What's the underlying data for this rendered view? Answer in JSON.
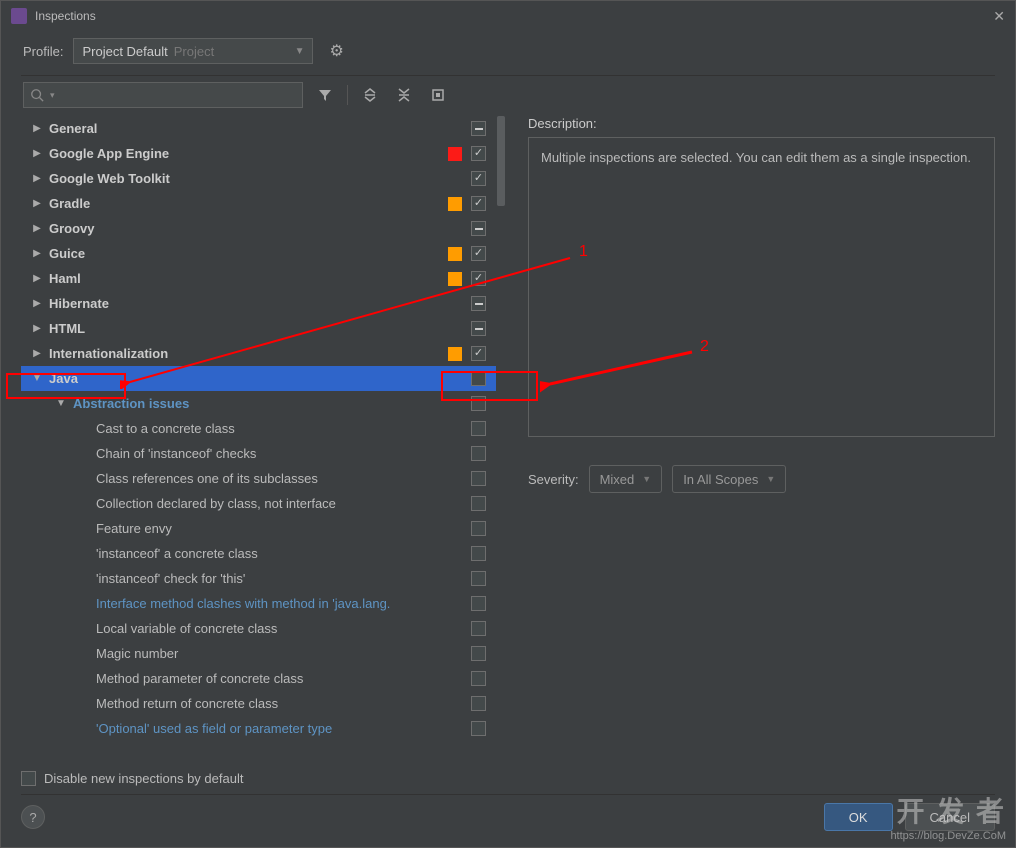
{
  "window": {
    "title": "Inspections"
  },
  "profile": {
    "label": "Profile:",
    "selected": "Project Default",
    "suffix": "Project"
  },
  "tree": {
    "top_level": [
      {
        "label": "General",
        "color": null,
        "checkbox": "mixed"
      },
      {
        "label": "Google App Engine",
        "color": "#fc1b17",
        "checkbox": "checked"
      },
      {
        "label": "Google Web Toolkit",
        "color": null,
        "checkbox": "checked"
      },
      {
        "label": "Gradle",
        "color": "#ff9c00",
        "checkbox": "checked"
      },
      {
        "label": "Groovy",
        "color": null,
        "checkbox": "mixed"
      },
      {
        "label": "Guice",
        "color": "#ff9c00",
        "checkbox": "checked"
      },
      {
        "label": "Haml",
        "color": "#ff9c00",
        "checkbox": "checked"
      },
      {
        "label": "Hibernate",
        "color": null,
        "checkbox": "mixed"
      },
      {
        "label": "HTML",
        "color": null,
        "checkbox": "mixed"
      },
      {
        "label": "Internationalization",
        "color": "#ff9c00",
        "checkbox": "checked"
      }
    ],
    "selected": {
      "label": "Java",
      "checkbox": "empty"
    },
    "subheader": {
      "label": "Abstraction issues",
      "checkbox": "empty"
    },
    "children": [
      {
        "label": "Cast to a concrete class",
        "link": false
      },
      {
        "label": "Chain of 'instanceof' checks",
        "link": false
      },
      {
        "label": "Class references one of its subclasses",
        "link": false
      },
      {
        "label": "Collection declared by class, not interface",
        "link": false
      },
      {
        "label": "Feature envy",
        "link": false
      },
      {
        "label": "'instanceof' a concrete class",
        "link": false
      },
      {
        "label": "'instanceof' check for 'this'",
        "link": false
      },
      {
        "label": "Interface method clashes with method in 'java.lang.",
        "link": true
      },
      {
        "label": "Local variable of concrete class",
        "link": false
      },
      {
        "label": "Magic number",
        "link": false
      },
      {
        "label": "Method parameter of concrete class",
        "link": false
      },
      {
        "label": "Method return of concrete class",
        "link": false
      },
      {
        "label": "'Optional' used as field or parameter type",
        "link": true
      }
    ]
  },
  "right": {
    "description_label": "Description:",
    "description_text": "Multiple inspections are selected. You can edit them as a single inspection.",
    "severity_label": "Severity:",
    "severity_value": "Mixed",
    "scope_value": "In All Scopes"
  },
  "footer": {
    "disable_label": "Disable new inspections by default",
    "ok": "OK",
    "cancel": "Cancel"
  },
  "annotations": {
    "label1": "1",
    "label2": "2"
  },
  "watermark": {
    "big": "开 发 者",
    "url": "https://blog.DevZe.CoM"
  }
}
